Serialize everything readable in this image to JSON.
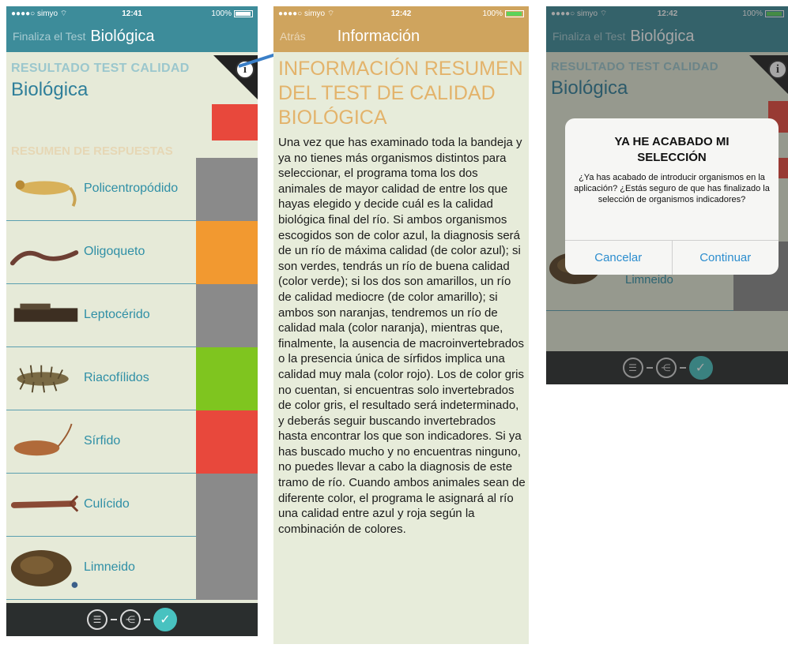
{
  "colors": {
    "teal_nav": "#3d8c9a",
    "gold_nav": "#cfa45e",
    "red": "#e8483c",
    "orange": "#f29930",
    "green": "#7fc51f",
    "gray": "#8a8a8a",
    "link_blue": "#2c8dce"
  },
  "screen1": {
    "status": {
      "carrier": "●●●●○ simyo ⌔",
      "time": "12:41",
      "battery": "100%"
    },
    "nav": {
      "back": "Finaliza el Test",
      "title": "Biológica"
    },
    "result_heading": "RESULTADO TEST CALIDAD",
    "result_subtitle": "Biológica",
    "result_color": "red",
    "info_icon": "info-icon",
    "summary_heading": "RESUMEN DE RESPUESTAS",
    "organisms": [
      {
        "name": "Policentropódido",
        "color": "gray",
        "icon": "caddisfly-larva-photo"
      },
      {
        "name": "Oligoqueto",
        "color": "orange",
        "icon": "worm-photo"
      },
      {
        "name": "Leptocérido",
        "color": "gray",
        "icon": "case-larva-photo"
      },
      {
        "name": "Riacofílidos",
        "color": "green",
        "icon": "larva-photo"
      },
      {
        "name": "Sírfido",
        "color": "red",
        "icon": "rat-tailed-larva-photo"
      },
      {
        "name": "Culícido",
        "color": "gray",
        "icon": "mosquito-larva-photo"
      },
      {
        "name": "Limneido",
        "color": "gray",
        "icon": "snail-photo"
      }
    ],
    "tabbar": [
      "list-icon",
      "network-icon",
      "check-icon"
    ]
  },
  "screen2": {
    "status": {
      "carrier": "●●●●○ simyo ⌔",
      "time": "12:42",
      "battery": "100%"
    },
    "nav": {
      "back": "Atrás",
      "title": "Información"
    },
    "title": "INFORMACIÓN RESUMEN DEL TEST DE CALIDAD BIOLÓGICA",
    "body": "Una vez que has examinado toda la bandeja y ya no tienes más organismos distintos para seleccionar, el programa toma los dos animales de mayor calidad de entre los que hayas elegido y decide cuál es la calidad biológica final del río. Si ambos organismos escogidos son de color azul, la diagnosis será de un río de máxima calidad (de color azul); si son verdes, tendrás un río de buena calidad (color verde); si los dos son amarillos, un río de calidad mediocre (de color amarillo); si ambos son naranjas, tendremos un río de calidad mala (color naranja), mientras que, finalmente, la ausencia de macroinvertebrados o la presencia única de sírfidos implica una calidad muy mala (color rojo). Los de color gris no cuentan, si encuentras solo invertebrados de color gris, el resultado será indeterminado, y deberás seguir buscando invertebrados hasta encontrar los que son indicadores. Si ya has buscado mucho y no encuentras ninguno, no puedes llevar a cabo la diagnosis de este tramo de río. Cuando ambos animales sean de diferente color, el programa le asignará al río una calidad entre azul y roja según la combinación de colores."
  },
  "screen3": {
    "status": {
      "carrier": "●●●●○ simyo ⌔",
      "time": "12:42",
      "battery": "100%"
    },
    "nav": {
      "back": "Finaliza el Test",
      "title": "Biológica"
    },
    "result_heading": "RESULTADO TEST CALIDAD",
    "result_subtitle": "Biológica",
    "partial_label": "Limneido",
    "dialog": {
      "title": "YA HE ACABADO MI SELECCIÓN",
      "message": "¿Ya has acabado de introducir organismos en la aplicación? ¿Estás seguro de que has finalizado la selección de organismos indicadores?",
      "cancel": "Cancelar",
      "continue": "Continuar"
    }
  }
}
